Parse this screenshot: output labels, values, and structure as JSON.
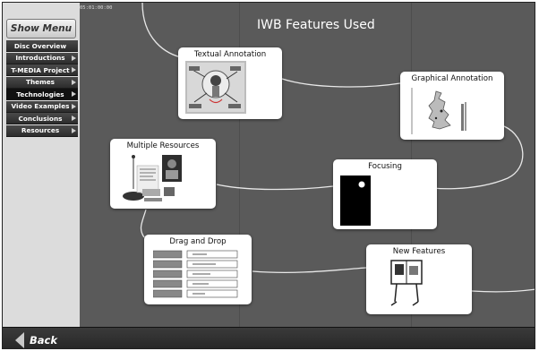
{
  "sidebar": {
    "menu_button": "Show Menu",
    "items": [
      {
        "label": "Disc Overview",
        "arrow": false,
        "selected": false
      },
      {
        "label": "Introductions",
        "arrow": true,
        "selected": false
      },
      {
        "label": "T-MEDIA Project",
        "arrow": true,
        "selected": false
      },
      {
        "label": "Themes",
        "arrow": true,
        "selected": false
      },
      {
        "label": "Technologies",
        "arrow": true,
        "selected": true
      },
      {
        "label": "Video Examples",
        "arrow": true,
        "selected": false
      },
      {
        "label": "Conclusions",
        "arrow": true,
        "selected": false
      },
      {
        "label": "Resources",
        "arrow": true,
        "selected": false
      }
    ]
  },
  "canvas": {
    "timecode": "05:01:00:00",
    "title": "IWB Features Used"
  },
  "nodes": {
    "textual": "Textual Annotation",
    "graphical": "Graphical Annotation",
    "multiple": "Multiple Resources",
    "focusing": "Focusing",
    "dragdrop": "Drag and Drop",
    "newfeatures": "New Features"
  },
  "bottom": {
    "back_label": "Back"
  },
  "colors": {
    "canvas": "#5a5a5a",
    "sidebar": "#dcdcdc",
    "nav_item": "#333333",
    "card": "#ffffff"
  }
}
